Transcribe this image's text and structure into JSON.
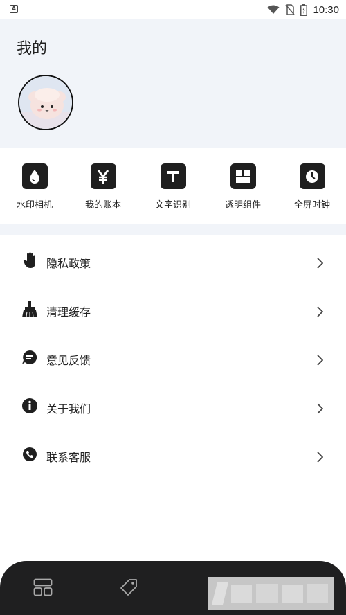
{
  "status_bar": {
    "app_icon_letter": "A",
    "time": "10:30",
    "icons": [
      "wifi-icon",
      "no-sim-icon",
      "battery-charging-icon"
    ]
  },
  "header": {
    "title": "我的",
    "avatar_icon": "avatar-image"
  },
  "shortcuts": [
    {
      "label": "水印相机",
      "icon": "water-drop-icon"
    },
    {
      "label": "我的账本",
      "icon": "yen-icon"
    },
    {
      "label": "文字识别",
      "icon": "text-t-icon"
    },
    {
      "label": "透明组件",
      "icon": "widget-grid-icon"
    },
    {
      "label": "全屏时钟",
      "icon": "clock-icon"
    }
  ],
  "menu": [
    {
      "label": "隐私政策",
      "icon": "hand-icon"
    },
    {
      "label": "清理缓存",
      "icon": "broom-icon"
    },
    {
      "label": "意见反馈",
      "icon": "chat-bubble-icon"
    },
    {
      "label": "关于我们",
      "icon": "info-icon"
    },
    {
      "label": "联系客服",
      "icon": "phone-icon"
    }
  ],
  "bottom_nav": {
    "items": [
      "dashboard-icon",
      "tag-icon"
    ],
    "background": "#1f1f20"
  },
  "colors": {
    "header_background": "#f1f4f9",
    "icon_dark": "#1f1f1f",
    "text": "#222222"
  }
}
